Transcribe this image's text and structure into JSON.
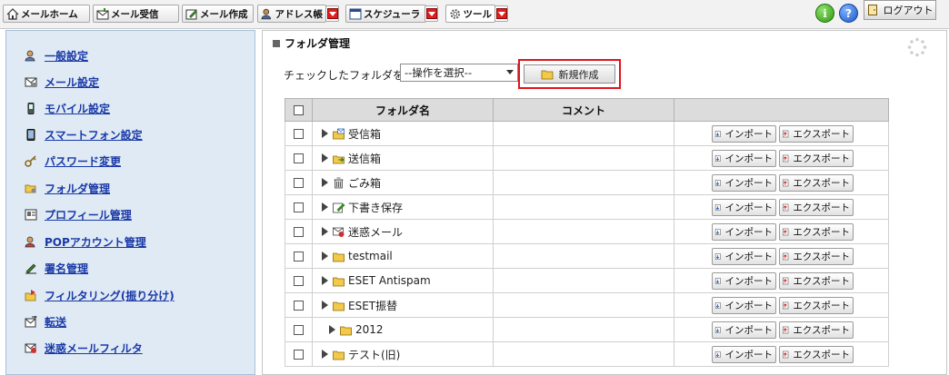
{
  "toolbar": {
    "mail_home": "メールホーム",
    "mail_receive": "メール受信",
    "mail_compose": "メール作成",
    "address_book": "アドレス帳",
    "scheduler": "スケジューラ",
    "tools": "ツール",
    "logout": "ログアウト",
    "info_glyph": "i",
    "help_glyph": "?"
  },
  "sidebar": {
    "items": [
      {
        "label": "一般設定",
        "icon": "person-gear-icon"
      },
      {
        "label": "メール設定",
        "icon": "mail-settings-icon"
      },
      {
        "label": "モバイル設定",
        "icon": "mobile-phone-icon"
      },
      {
        "label": "スマートフォン設定",
        "icon": "smartphone-icon"
      },
      {
        "label": "パスワード変更",
        "icon": "key-icon"
      },
      {
        "label": "フォルダ管理",
        "icon": "folder-gear-icon"
      },
      {
        "label": "プロフィール管理",
        "icon": "profile-card-icon"
      },
      {
        "label": "POPアカウント管理",
        "icon": "pop-account-icon"
      },
      {
        "label": "署名管理",
        "icon": "signature-pen-icon"
      },
      {
        "label": "フィルタリング(振り分け)",
        "icon": "filter-folder-icon"
      },
      {
        "label": "転送",
        "icon": "forward-mail-icon"
      },
      {
        "label": "迷惑メールフィルタ",
        "icon": "spam-filter-icon"
      }
    ]
  },
  "main": {
    "title": "フォルダ管理",
    "checked_label": "チェックしたフォルダを",
    "operation_select": "--操作を選択--",
    "new_button": "新規作成",
    "table": {
      "headers": [
        "フォルダ名",
        "コメント"
      ],
      "import_label": "インポート",
      "export_label": "エクスポート",
      "rows": [
        {
          "name": "受信箱",
          "icon": "inbox-icon",
          "indent": 0
        },
        {
          "name": "送信箱",
          "icon": "outbox-icon",
          "indent": 0
        },
        {
          "name": "ごみ箱",
          "icon": "trash-icon",
          "indent": 0
        },
        {
          "name": "下書き保存",
          "icon": "draft-icon",
          "indent": 0
        },
        {
          "name": "迷惑メール",
          "icon": "spam-mail-icon",
          "indent": 0
        },
        {
          "name": "testmail",
          "icon": "folder-icon",
          "indent": 0
        },
        {
          "name": "ESET Antispam",
          "icon": "folder-icon",
          "indent": 0
        },
        {
          "name": "ESET振替",
          "icon": "folder-icon",
          "indent": 0
        },
        {
          "name": "2012",
          "icon": "folder-icon",
          "indent": 1
        },
        {
          "name": "テスト(旧)",
          "icon": "folder-icon",
          "indent": 0
        }
      ]
    }
  },
  "colors": {
    "sidebar_bg": "#dfeaf5",
    "link": "#1a39a6",
    "highlight": "#e0141b",
    "dropdown_red": "#e21d1d"
  }
}
